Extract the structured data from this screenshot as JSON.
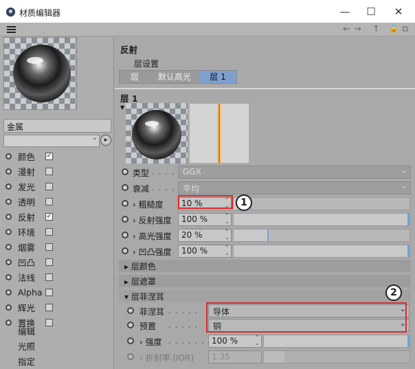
{
  "window": {
    "title": "材质编辑器",
    "min_icon": "minimize-icon",
    "max_icon": "maximize-icon",
    "close_icon": "close-icon",
    "min_glyph": "—",
    "max_glyph": "☐",
    "close_glyph": "✕"
  },
  "toolbar": {
    "nav_back": "←",
    "nav_fwd": "→",
    "nav_up": "↑",
    "lock": "🔓",
    "newwin": "⧉"
  },
  "left": {
    "material_name": "金属",
    "channels": [
      {
        "label": "颜色",
        "checked": true,
        "check": "✓"
      },
      {
        "label": "漫射",
        "checked": false,
        "check": ""
      },
      {
        "label": "发光",
        "checked": false,
        "check": ""
      },
      {
        "label": "透明",
        "checked": false,
        "check": ""
      },
      {
        "label": "反射",
        "checked": true,
        "check": "✓"
      },
      {
        "label": "环境",
        "checked": false,
        "check": ""
      },
      {
        "label": "烟雾",
        "checked": false,
        "check": ""
      },
      {
        "label": "凹凸",
        "checked": false,
        "check": ""
      },
      {
        "label": "法线",
        "checked": false,
        "check": ""
      },
      {
        "label": "Alpha",
        "checked": false,
        "check": ""
      },
      {
        "label": "辉光",
        "checked": false,
        "check": ""
      },
      {
        "label": "置换",
        "checked": false,
        "check": ""
      }
    ],
    "extra_items": [
      "编辑",
      "光照",
      "指定"
    ]
  },
  "right": {
    "section_title": "反射",
    "layer_settings": "层设置",
    "tabs": [
      "层",
      "默认高光",
      "层 1"
    ],
    "layer_title": "层 1",
    "type_label": "类型",
    "type_value": "GGX",
    "atten_label": "衰减",
    "atten_value": "平均",
    "sliders": [
      {
        "label": "› 粗糙度",
        "value": "10 %",
        "fraction": 0.1
      },
      {
        "label": "› 反射强度",
        "value": "100 %",
        "fraction": 1.0
      },
      {
        "label": "› 高光强度",
        "value": "20 %",
        "fraction": 0.2
      },
      {
        "label": "› 凹凸强度",
        "value": "100 %",
        "fraction": 1.0
      }
    ],
    "folds": [
      "▸ 层颜色",
      "▸ 层遮罩",
      "▾ 层菲涅耳"
    ],
    "fresnel_label": "菲涅耳",
    "fresnel_value": "导体",
    "preset_label": "预置",
    "preset_value": "铜",
    "strength_label": "› 强度",
    "strength_value": "100 %",
    "ior_label": "› 折射率 (IOR)",
    "ior_value": "1.35"
  },
  "callouts": [
    "1",
    "2"
  ],
  "colors": {
    "tab_active": "#7f9fcf",
    "highlight": "#d92a2a",
    "slider_edge": "#6aa5d9"
  }
}
